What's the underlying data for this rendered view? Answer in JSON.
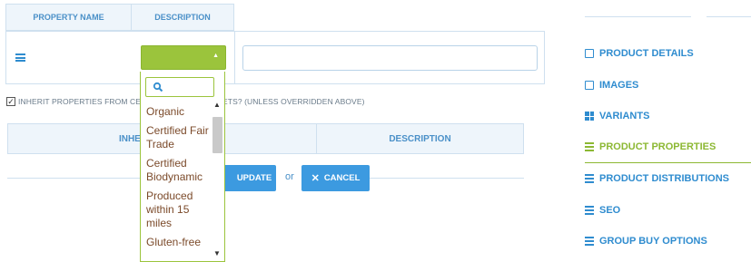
{
  "property_table": {
    "headers": [
      "PROPERTY NAME",
      "DESCRIPTION"
    ],
    "description_value": "",
    "description_placeholder": ""
  },
  "dropdown": {
    "search_value": "",
    "options": [
      "Organic",
      "Certified Fair Trade",
      "Certified Biodynamic",
      "Produced within 15 miles",
      "Gluten-free"
    ]
  },
  "inherit": {
    "checked": true,
    "label": "INHERIT PROPERTIES FROM CE",
    "label_suffix": "RKETS? (UNLESS OVERRIDDEN ABOVE)"
  },
  "inherited_table": {
    "headers": [
      "INHER",
      "DESCRIPTION"
    ]
  },
  "actions": {
    "update_label": "UPDATE",
    "or_text": "or",
    "cancel_label": "CANCEL"
  },
  "sidebar": {
    "items": [
      {
        "label": "PRODUCT DETAILS",
        "icon": "edit-icon"
      },
      {
        "label": "IMAGES",
        "icon": "image-icon"
      },
      {
        "label": "VARIANTS",
        "icon": "grid-icon"
      },
      {
        "label": "PRODUCT PROPERTIES",
        "icon": "list-icon",
        "active": true
      },
      {
        "label": "PRODUCT DISTRIBUTIONS",
        "icon": "list-icon"
      },
      {
        "label": "SEO",
        "icon": "list-icon"
      },
      {
        "label": "GROUP BUY OPTIONS",
        "icon": "list-icon"
      }
    ]
  },
  "colors": {
    "accent_blue": "#3c9ae0",
    "accent_green": "#9bc43c",
    "header_bg": "#eef5fb"
  }
}
